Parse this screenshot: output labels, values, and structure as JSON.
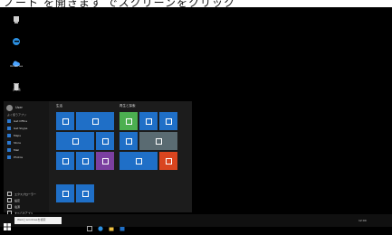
{
  "caption": "ノート を開きます でスクリーンをクリック",
  "desktop": {
    "icons": [
      {
        "label": "PC",
        "icon": "this-pc-icon"
      },
      {
        "label": "",
        "icon": "edge-icon"
      },
      {
        "label": "OneDrive",
        "icon": "onedrive-icon"
      },
      {
        "label": "ごみ箱",
        "icon": "recycle-bin-icon"
      }
    ]
  },
  "start_menu": {
    "user_name": "User",
    "most_used_label": "よく使うアプリ",
    "apps": [
      {
        "label": "Get Office"
      },
      {
        "label": "Get Skype"
      },
      {
        "label": "Maps"
      },
      {
        "label": "Store"
      },
      {
        "label": "Mail"
      },
      {
        "label": "Photos"
      }
    ],
    "bottom_items": [
      {
        "label": "エクスプローラー"
      },
      {
        "label": "設定"
      },
      {
        "label": "電源"
      },
      {
        "label": "すべてのアプリ"
      }
    ],
    "group_left_title": "生活",
    "group_right_title": "再生と探索",
    "tiles": [
      {
        "label": "",
        "color": "#1f6fc7",
        "icon": "calendar-icon"
      },
      {
        "label": "",
        "color": "#1f6fc7",
        "icon": "mail-icon"
      },
      {
        "label": "",
        "color": "#1f6fc7",
        "icon": "edge-icon"
      },
      {
        "label": "",
        "color": "#1f6fc7",
        "icon": "photos-icon"
      },
      {
        "label": "",
        "color": "#1f6fc7",
        "icon": "cortana-icon"
      },
      {
        "label": "",
        "color": "#1f6fc7",
        "icon": "weather-icon"
      },
      {
        "label": "",
        "color": "#1f6fc7",
        "icon": "phone-icon"
      },
      {
        "label": "",
        "color": "#4caf50",
        "icon": "xbox-icon"
      },
      {
        "label": "",
        "color": "#1f6fc7",
        "icon": "groove-icon"
      },
      {
        "label": "",
        "color": "#1f6fc7",
        "icon": "movies-icon"
      },
      {
        "label": "",
        "color": "#6b4c3b",
        "icon": "news-icon"
      },
      {
        "label": "",
        "color": "#1f6fc7",
        "icon": "store-icon"
      },
      {
        "label": "",
        "color": "#1f6fc7",
        "icon": "settings-icon"
      },
      {
        "label": "",
        "color": "#1f6fc7",
        "icon": "skype-icon"
      },
      {
        "label": "",
        "color": "#7b3fa0",
        "icon": "onenote-icon"
      },
      {
        "label": "",
        "color": "#1f6fc7",
        "icon": "outlook-icon"
      },
      {
        "label": "",
        "color": "#d9451f",
        "icon": "office-icon"
      },
      {
        "label": "",
        "color": "#1f6fc7",
        "icon": "skype-video-icon"
      },
      {
        "label": "",
        "color": "#1f6fc7",
        "icon": "twitter-icon"
      }
    ]
  },
  "taskbar": {
    "search_placeholder": "Webとwindowsを検索",
    "clock": "12:00"
  }
}
